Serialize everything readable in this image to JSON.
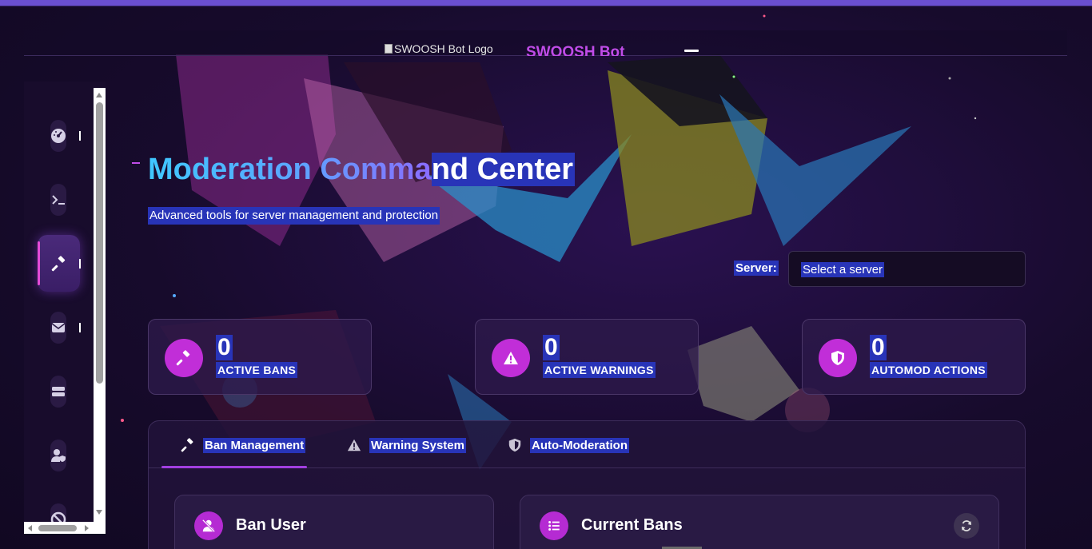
{
  "header": {
    "logo_alt": "SWOOSH Bot Logo",
    "brand": "SWOOSH Bot"
  },
  "sidebar": {
    "items": [
      {
        "icon": "dashboard-icon"
      },
      {
        "icon": "terminal-icon"
      },
      {
        "icon": "gavel-icon",
        "active": true
      },
      {
        "icon": "envelope-icon"
      },
      {
        "icon": "server-icon"
      },
      {
        "icon": "user-shield-icon"
      },
      {
        "icon": "ban-icon"
      }
    ]
  },
  "hero": {
    "title_part1": "Moderation Comma",
    "title_part2": "nd Center",
    "subtitle": "Advanced tools for server management and protection"
  },
  "server": {
    "label": "Server:",
    "selected": "Select a server"
  },
  "stats": [
    {
      "value": "0",
      "label": "ACTIVE BANS",
      "icon": "gavel-icon"
    },
    {
      "value": "0",
      "label": "ACTIVE WARNINGS",
      "icon": "warning-icon"
    },
    {
      "value": "0",
      "label": "AUTOMOD ACTIONS",
      "icon": "shield-icon"
    }
  ],
  "tabs": [
    {
      "label": "Ban Management",
      "icon": "gavel-icon",
      "active": true
    },
    {
      "label": "Warning System",
      "icon": "warning-icon"
    },
    {
      "label": "Auto-Moderation",
      "icon": "shield-icon"
    }
  ],
  "cards": {
    "ban_user": {
      "title": "Ban User",
      "icon": "user-slash-icon"
    },
    "current_bans": {
      "title": "Current Bans",
      "icon": "list-icon",
      "action_icon": "refresh-icon"
    }
  },
  "colors": {
    "accent": "#c12ed8",
    "selection": "#2834b8",
    "brand": "#c04ce8"
  }
}
